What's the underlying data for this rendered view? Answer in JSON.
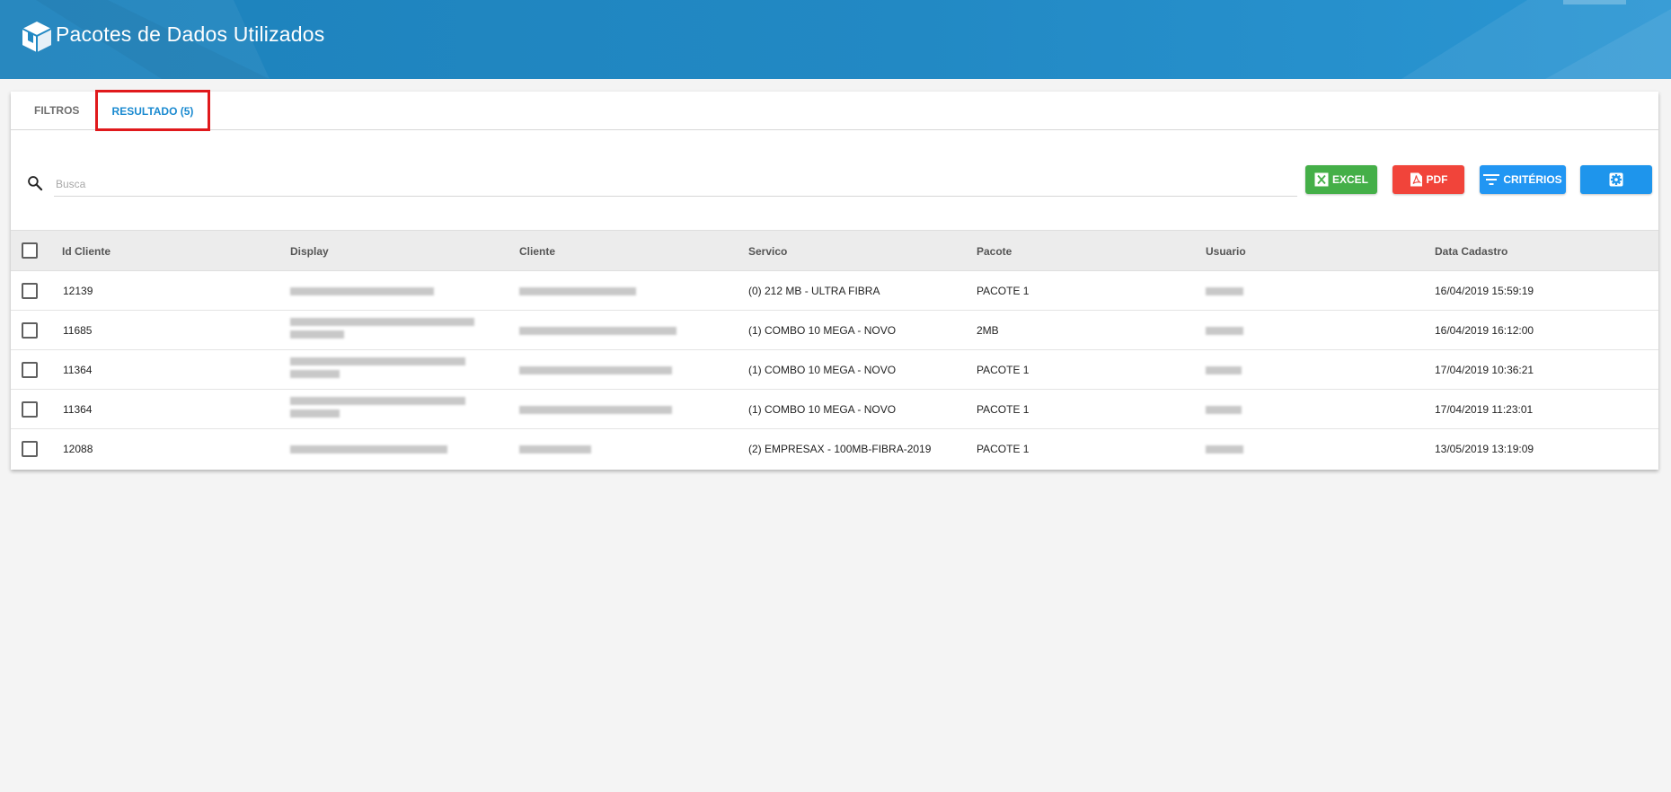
{
  "header": {
    "title": "Pacotes de Dados Utilizados",
    "logo_icon": "box-cube-icon"
  },
  "tabs": {
    "filters_label": "FILTROS",
    "result_label": "RESULTADO (5)"
  },
  "search": {
    "placeholder": "Busca",
    "icon": "search-icon"
  },
  "toolbar": {
    "excel_label": "EXCEL",
    "pdf_label": "PDF",
    "criteria_label": "CRITÉRIOS",
    "settings_icon": "gear-icon"
  },
  "colors": {
    "header": "#2289c4",
    "excel": "#44af48",
    "pdf": "#f1443a",
    "criteria": "#2196f3",
    "active_tab": "#1a8ad0",
    "highlight_border": "#e0191c"
  },
  "table": {
    "columns": [
      "Id Cliente",
      "Display",
      "Cliente",
      "Servico",
      "Pacote",
      "Usuario",
      "Data Cadastro"
    ],
    "rows": [
      {
        "id_cliente": "12139",
        "servico": "(0) 212 MB - ULTRA FIBRA",
        "pacote": "PACOTE 1",
        "data_cadastro": "16/04/2019 15:59:19"
      },
      {
        "id_cliente": "11685",
        "servico": "(1) COMBO 10 MEGA - NOVO",
        "pacote": "2MB",
        "data_cadastro": "16/04/2019 16:12:00"
      },
      {
        "id_cliente": "11364",
        "servico": "(1) COMBO 10 MEGA - NOVO",
        "pacote": "PACOTE 1",
        "data_cadastro": "17/04/2019 10:36:21"
      },
      {
        "id_cliente": "11364",
        "servico": "(1) COMBO 10 MEGA - NOVO",
        "pacote": "PACOTE 1",
        "data_cadastro": "17/04/2019 11:23:01"
      },
      {
        "id_cliente": "12088",
        "servico": "(2) EMPRESAX - 100MB-FIBRA-2019",
        "pacote": "PACOTE 1",
        "data_cadastro": "13/05/2019 13:19:09"
      }
    ]
  }
}
